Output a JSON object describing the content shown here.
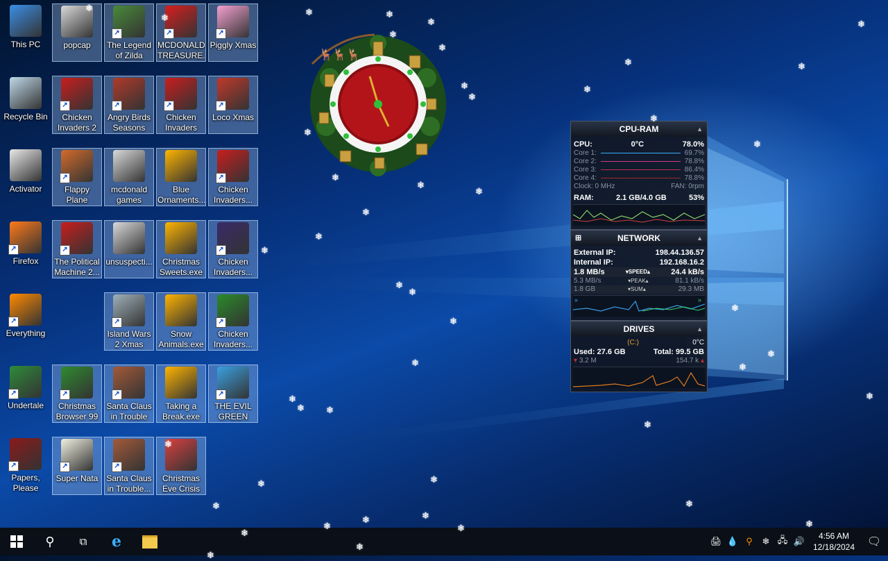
{
  "desktop": {
    "icons": [
      {
        "label": "This PC",
        "icon": "computer-icon",
        "color": "#3a8ee6",
        "selected": false,
        "shortcut": false
      },
      {
        "label": "Recycle Bin",
        "icon": "recycle-bin-icon",
        "color": "#bfd8e8",
        "selected": false,
        "shortcut": false
      },
      {
        "label": "Activator",
        "icon": "file-icon",
        "color": "#e8e8e8",
        "selected": false,
        "shortcut": false
      },
      {
        "label": "Firefox",
        "icon": "firefox-icon",
        "color": "#ff7a1a",
        "selected": false,
        "shortcut": true
      },
      {
        "label": "Everything",
        "icon": "magnifier-icon",
        "color": "#ff8a00",
        "selected": false,
        "shortcut": true
      },
      {
        "label": "Undertale",
        "icon": "undertale-icon",
        "color": "#2e8b3a",
        "selected": false,
        "shortcut": true
      },
      {
        "label": "Papers, Please",
        "icon": "papers-please-icon",
        "color": "#8b1a1a",
        "selected": false,
        "shortcut": true
      },
      {
        "label": "popcap",
        "icon": "folder-icon",
        "color": "#d9d9d9",
        "selected": true,
        "shortcut": false
      },
      {
        "label": "Chicken Invaders 2",
        "icon": "chicken-icon",
        "color": "#c81e1e",
        "selected": true,
        "shortcut": true
      },
      {
        "label": "Flappy Plane",
        "icon": "plane-icon",
        "color": "#d36b2a",
        "selected": true,
        "shortcut": true
      },
      {
        "label": "Christmas Browser 99",
        "icon": "tree-icon",
        "color": "#2f8a2f",
        "selected": true,
        "shortcut": true
      },
      {
        "label": "Super Nata",
        "icon": "pixel-icon",
        "color": "#f0f0e0",
        "selected": true,
        "shortcut": true
      },
      {
        "label": "The Legend of Zilda",
        "icon": "zilda-icon",
        "color": "#4a8a3a",
        "selected": true,
        "shortcut": true
      },
      {
        "label": "Angry Birds Seasons",
        "icon": "angry-birds-icon",
        "color": "#b03a2a",
        "selected": true,
        "shortcut": true
      },
      {
        "label": "mcdonald games",
        "icon": "folder-icon",
        "color": "#d9d9d9",
        "selected": true,
        "shortcut": false
      },
      {
        "label": "unsuspecti...",
        "icon": "folder-icon",
        "color": "#d9d9d9",
        "selected": true,
        "shortcut": false
      },
      {
        "label": "Island Wars 2 Xmas",
        "icon": "island-icon",
        "color": "#9fb0b8",
        "selected": true,
        "shortcut": true
      },
      {
        "label": "Santa Claus in Trouble",
        "icon": "santa-icon",
        "color": "#a35a3a",
        "selected": true,
        "shortcut": true
      },
      {
        "label": "Santa Claus in Trouble...",
        "icon": "santa-icon",
        "color": "#a35a3a",
        "selected": true,
        "shortcut": true
      },
      {
        "label": "MCDONALDS TREASURE...",
        "icon": "mcdonalds-icon",
        "color": "#d81e1e",
        "selected": true,
        "shortcut": true
      },
      {
        "label": "Chicken Invaders C...",
        "icon": "chicken-icon",
        "color": "#c81e1e",
        "selected": true,
        "shortcut": true
      },
      {
        "label": "Blue Ornaments...",
        "icon": "setup-icon",
        "color": "#ffb400",
        "selected": true,
        "shortcut": false
      },
      {
        "label": "Christmas Sweets.exe",
        "icon": "setup-icon",
        "color": "#ffb400",
        "selected": true,
        "shortcut": false
      },
      {
        "label": "Snow Animals.exe",
        "icon": "setup-icon",
        "color": "#ffb400",
        "selected": true,
        "shortcut": false
      },
      {
        "label": "Taking a Break.exe",
        "icon": "setup-icon",
        "color": "#ffb400",
        "selected": true,
        "shortcut": false
      },
      {
        "label": "Christmas Eve Crisis",
        "icon": "santa-icon",
        "color": "#d84040",
        "selected": true,
        "shortcut": false
      },
      {
        "label": "Piggly Xmas",
        "icon": "pig-icon",
        "color": "#f4a0d0",
        "selected": true,
        "shortcut": true
      },
      {
        "label": "Loco Xmas",
        "icon": "bear-icon",
        "color": "#c0392b",
        "selected": true,
        "shortcut": true
      },
      {
        "label": "Chicken Invaders...",
        "icon": "chicken-icon",
        "color": "#c81e1e",
        "selected": true,
        "shortcut": true
      },
      {
        "label": "Chicken Invaders...",
        "icon": "chicken-icon",
        "color": "#3a2a6a",
        "selected": true,
        "shortcut": true
      },
      {
        "label": "Chicken Invaders...",
        "icon": "chicken-icon",
        "color": "#2a8a2a",
        "selected": true,
        "shortcut": true
      },
      {
        "label": "THE EVIL GREEN ME...",
        "icon": "messenger-icon",
        "color": "#3aa0e0",
        "selected": true,
        "shortcut": true
      },
      {
        "label": "The Political Machine 2...",
        "icon": "political-icon",
        "color": "#c81e1e",
        "selected": true,
        "shortcut": true
      }
    ]
  },
  "monitor": {
    "cpu_ram": {
      "title": "CPU-RAM",
      "cpu_label": "CPU:",
      "cpu_temp": "0°C",
      "cpu_pct": "78.0%",
      "cores": [
        {
          "label": "Core 1:",
          "value": "69.7%"
        },
        {
          "label": "Core 2:",
          "value": "78.8%"
        },
        {
          "label": "Core 3:",
          "value": "86.4%"
        },
        {
          "label": "Core 4:",
          "value": "78.8%"
        }
      ],
      "clock": "Clock: 0 MHz",
      "fan": "FAN: 0rpm",
      "ram_label": "RAM:",
      "ram_used": "2.1 GB/4.0 GB",
      "ram_pct": "53%"
    },
    "network": {
      "title": "NETWORK",
      "external_label": "External IP:",
      "external_ip": "198.44.136.57",
      "internal_label": "Internal IP:",
      "internal_ip": "192.168.16.2",
      "speed_down": "1.8 MB/s",
      "speed_label": "SPEED",
      "speed_up": "24.4 kB/s",
      "peak_down": "5.3 MB/s",
      "peak_label": "PEAK",
      "peak_up": "81.1 kB/s",
      "sum_down": "1.8 GB",
      "sum_label": "SUM",
      "sum_up": "29.3 MB"
    },
    "drives": {
      "title": "DRIVES",
      "drive": "(C:)",
      "temp": "0°C",
      "used": "Used: 27.6 GB",
      "total": "Total: 99.5 GB",
      "read": "3.2 M",
      "write": "154.7 k"
    }
  },
  "taskbar": {
    "time": "4:56 AM",
    "date": "12/18/2024"
  },
  "colors": {
    "accent": "#1e90ff",
    "taskbar_bg": "#0a0f18",
    "gadget_bg": "#101622"
  }
}
